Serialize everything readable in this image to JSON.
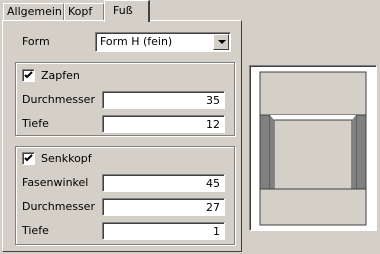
{
  "tabs": [
    {
      "label": "Allgemein"
    },
    {
      "label": "Kopf"
    },
    {
      "label": "Fuß",
      "active": true
    }
  ],
  "form": {
    "label": "Form",
    "selected": "Form H (fein)"
  },
  "zapfen": {
    "label": "Zapfen",
    "checked": true,
    "durchmesser_label": "Durchmesser",
    "durchmesser_value": "35",
    "tiefe_label": "Tiefe",
    "tiefe_value": "12"
  },
  "senkkopf": {
    "label": "Senkkopf",
    "checked": true,
    "fasenwinkel_label": "Fasenwinkel",
    "fasenwinkel_value": "45",
    "durchmesser_label": "Durchmesser",
    "durchmesser_value": "27",
    "tiefe_label": "Tiefe",
    "tiefe_value": "1"
  },
  "colors": {
    "window_bg": "#d4d0c8",
    "preview_fill": "#d4d0c8",
    "preview_dark": "#808080"
  }
}
